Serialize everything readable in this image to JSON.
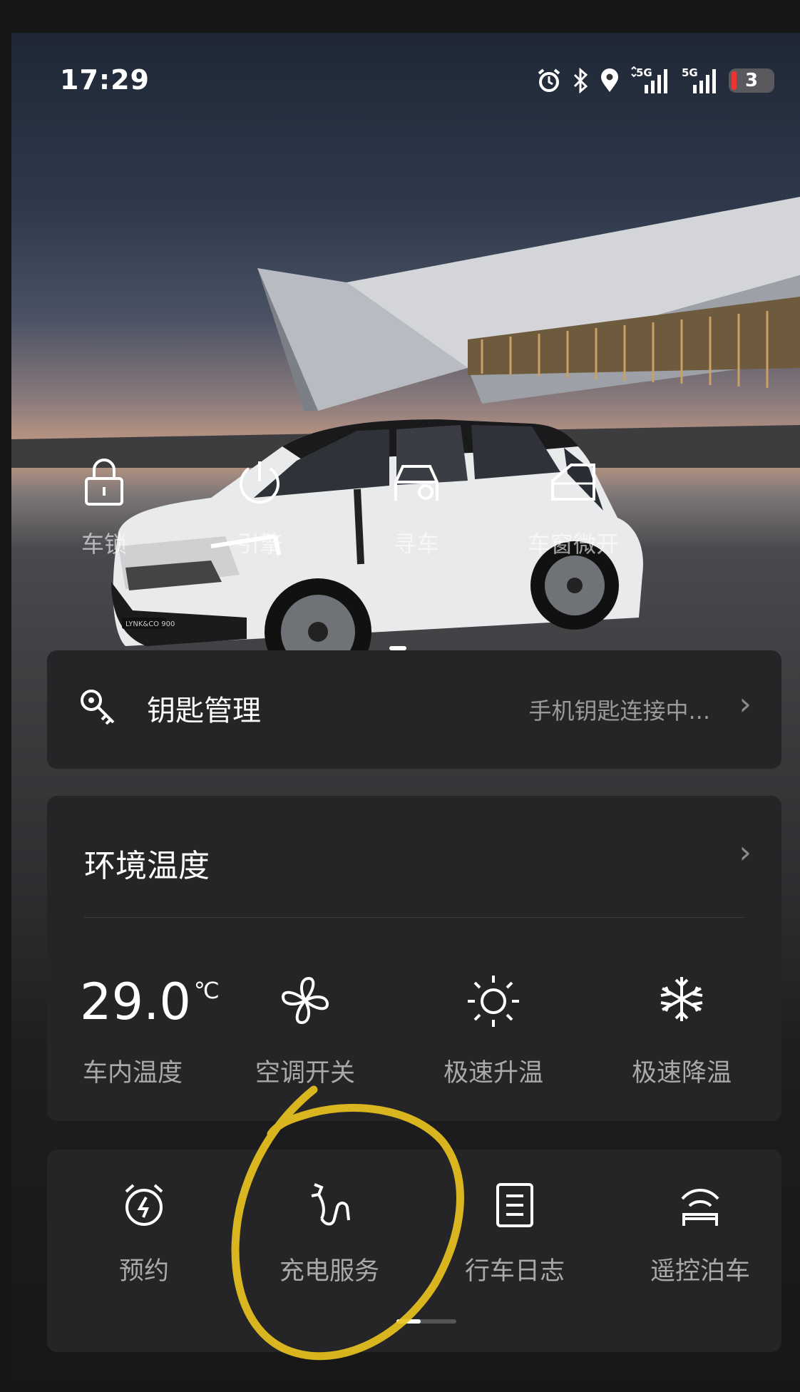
{
  "status_bar": {
    "time": "17:29",
    "battery": "3",
    "icons": [
      "alarm-icon",
      "bluetooth-icon",
      "location-icon",
      "signal-5g-icon",
      "signal-5g-icon"
    ],
    "network_labels": [
      "5G",
      "5G"
    ]
  },
  "quick_actions": [
    {
      "label": "车锁",
      "icon": "lock-icon"
    },
    {
      "label": "引擎",
      "icon": "power-icon"
    },
    {
      "label": "寻车",
      "icon": "find-car-icon"
    },
    {
      "label": "车窗微开",
      "icon": "window-icon"
    }
  ],
  "car_badge": "LYNK&CO 900",
  "key_card": {
    "title": "钥匙管理",
    "status": "手机钥匙连接中...",
    "icon": "key-icon"
  },
  "environment": {
    "title": "环境温度",
    "temperature": "29.0",
    "unit": "℃",
    "temp_label": "车内温度",
    "actions": [
      {
        "label": "空调开关",
        "icon": "fan-icon"
      },
      {
        "label": "极速升温",
        "icon": "sun-icon"
      },
      {
        "label": "极速降温",
        "icon": "snowflake-icon"
      }
    ]
  },
  "services": [
    {
      "label": "预约",
      "icon": "alarm-clock-bolt-icon"
    },
    {
      "label": "充电服务",
      "icon": "charging-plug-icon"
    },
    {
      "label": "行车日志",
      "icon": "log-icon"
    },
    {
      "label": "遥控泊车",
      "icon": "remote-parking-icon"
    }
  ],
  "colors": {
    "card_bg": "#252527",
    "annotation": "#e8c21e",
    "battery_low": "#e33333"
  }
}
